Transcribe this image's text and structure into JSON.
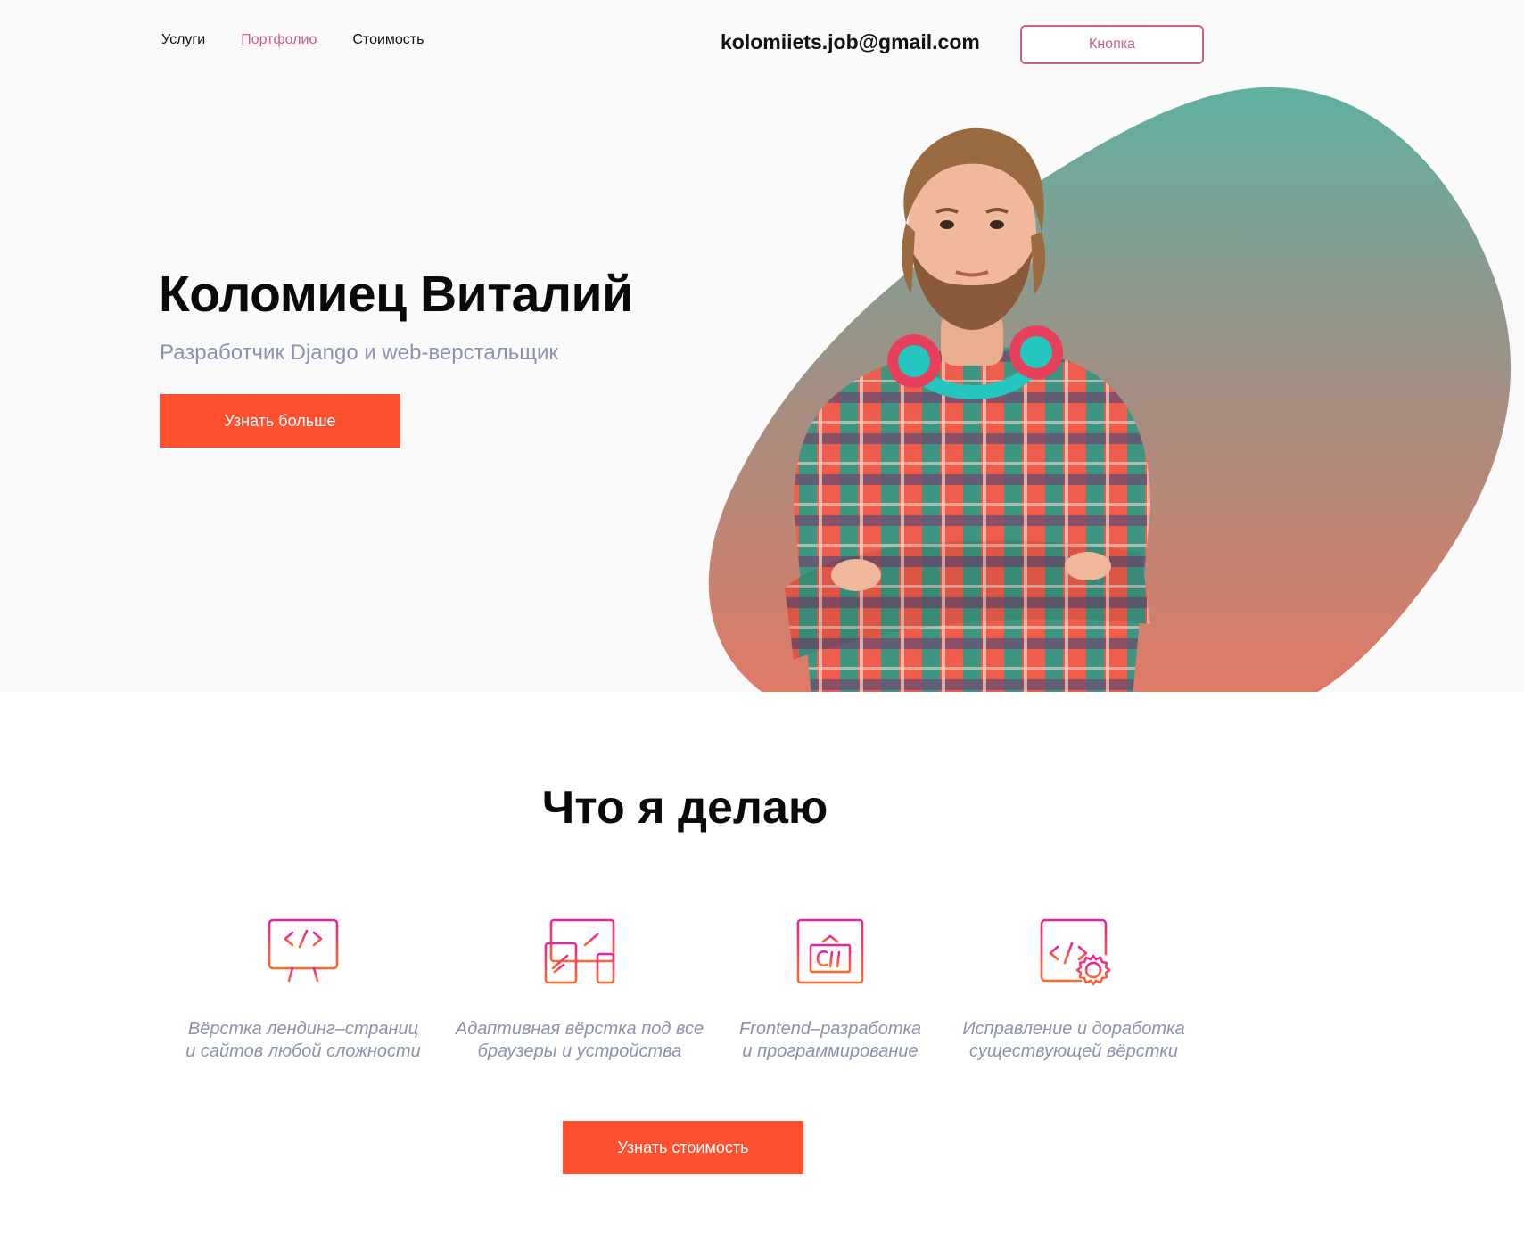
{
  "nav": {
    "items": [
      {
        "label": "Услуги",
        "active": false
      },
      {
        "label": "Портфолио",
        "active": true
      },
      {
        "label": "Стоимость",
        "active": false
      }
    ]
  },
  "header": {
    "email": "kolomiiets.job@gmail.com",
    "button_label": "Кнопка"
  },
  "hero": {
    "title": "Коломиец Виталий",
    "subtitle": "Разработчик Django и web-верстальщик",
    "cta_label": "Узнать больше"
  },
  "services": {
    "title": "Что я делаю",
    "items": [
      {
        "icon": "monitor-code-icon",
        "line1": "Вёрстка лендинг–страниц",
        "line2": "и сайтов любой сложности"
      },
      {
        "icon": "responsive-devices-icon",
        "line1": "Адаптивная вёрстка под все",
        "line2": "браузеры и устройства"
      },
      {
        "icon": "csharp-window-icon",
        "line1": "Frontend–разработка",
        "line2": "и программирование"
      },
      {
        "icon": "code-settings-icon",
        "line1": "Исправление и доработка",
        "line2": "существующей вёрстки"
      }
    ],
    "cta_label": "Узнать стоимость"
  },
  "colors": {
    "accent": "#ff5030",
    "pink": "#cc5f8a",
    "muted_text": "#8b92ad",
    "hero_bg": "#fafafa",
    "blob_top": "#5fb0a3",
    "blob_bottom": "#e07a65",
    "icon_gradient_top": "#e8239a",
    "icon_gradient_bottom": "#ff6a2a"
  }
}
